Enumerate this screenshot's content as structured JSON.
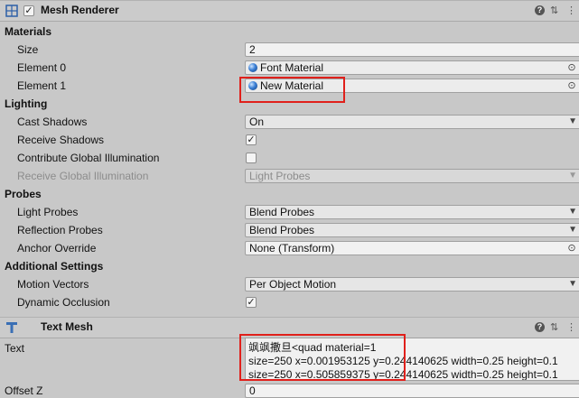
{
  "mesh_renderer": {
    "title": "Mesh Renderer",
    "icon": "mesh-renderer-icon",
    "enabled": true,
    "sections": {
      "materials": "Materials",
      "lighting": "Lighting",
      "probes": "Probes",
      "additional": "Additional Settings"
    },
    "size_label": "Size",
    "size_value": "2",
    "element0_label": "Element 0",
    "element0_value": "Font Material",
    "element1_label": "Element 1",
    "element1_value": "New Material",
    "cast_shadows_label": "Cast Shadows",
    "cast_shadows_value": "On",
    "receive_shadows_label": "Receive Shadows",
    "receive_shadows_checked": true,
    "contribute_gi_label": "Contribute Global Illumination",
    "contribute_gi_checked": false,
    "receive_gi_label": "Receive Global Illumination",
    "receive_gi_value": "Light Probes",
    "light_probes_label": "Light Probes",
    "light_probes_value": "Blend Probes",
    "reflection_probes_label": "Reflection Probes",
    "reflection_probes_value": "Blend Probes",
    "anchor_override_label": "Anchor Override",
    "anchor_override_value": "None (Transform)",
    "motion_vectors_label": "Motion Vectors",
    "motion_vectors_value": "Per Object Motion",
    "dynamic_occlusion_label": "Dynamic Occlusion",
    "dynamic_occlusion_checked": true
  },
  "text_mesh": {
    "title": "Text Mesh",
    "icon": "text-mesh-icon",
    "text_label": "Text",
    "text_line1": "飒飒撒旦<quad material=1",
    "text_line2": "size=250 x=0.001953125 y=0.244140625 width=0.25 height=0.1",
    "text_line3": "size=250 x=0.505859375 y=0.244140625 width=0.25 height=0.1",
    "offset_z_label": "Offset Z",
    "offset_z_value": "0"
  },
  "glyphs": {
    "check": "✓",
    "dropdown": "▼",
    "target": "⊙",
    "help": "?",
    "settings": "⇅",
    "more": "⋮"
  },
  "colors": {
    "highlight": "#e0201b",
    "material_ball": "#3a7fd6"
  }
}
